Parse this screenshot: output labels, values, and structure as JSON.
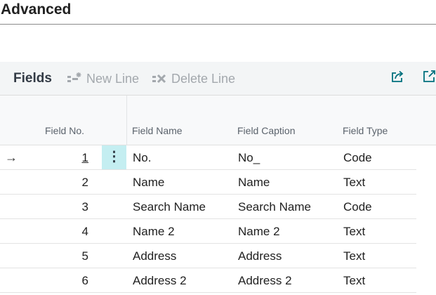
{
  "section": {
    "title": "Advanced"
  },
  "toolbar": {
    "title": "Fields",
    "new_line": "New Line",
    "delete_line": "Delete Line",
    "share_icon": "share-icon",
    "expand_icon": "expand-icon"
  },
  "columns": {
    "field_no": "Field No.",
    "field_name": "Field Name",
    "field_caption": "Field Caption",
    "field_type": "Field Type"
  },
  "rows": [
    {
      "no": "1",
      "name": "No.",
      "caption": "No_",
      "type": "Code",
      "current": true
    },
    {
      "no": "2",
      "name": "Name",
      "caption": "Name",
      "type": "Text"
    },
    {
      "no": "3",
      "name": "Search Name",
      "caption": "Search Name",
      "type": "Code"
    },
    {
      "no": "4",
      "name": "Name 2",
      "caption": "Name 2",
      "type": "Text"
    },
    {
      "no": "5",
      "name": "Address",
      "caption": "Address",
      "type": "Text"
    },
    {
      "no": "6",
      "name": "Address 2",
      "caption": "Address 2",
      "type": "Text"
    }
  ],
  "colors": {
    "accent": "#00707d",
    "selected_cell": "#c4eef1",
    "toolbar_bg": "#f3f5f6"
  }
}
